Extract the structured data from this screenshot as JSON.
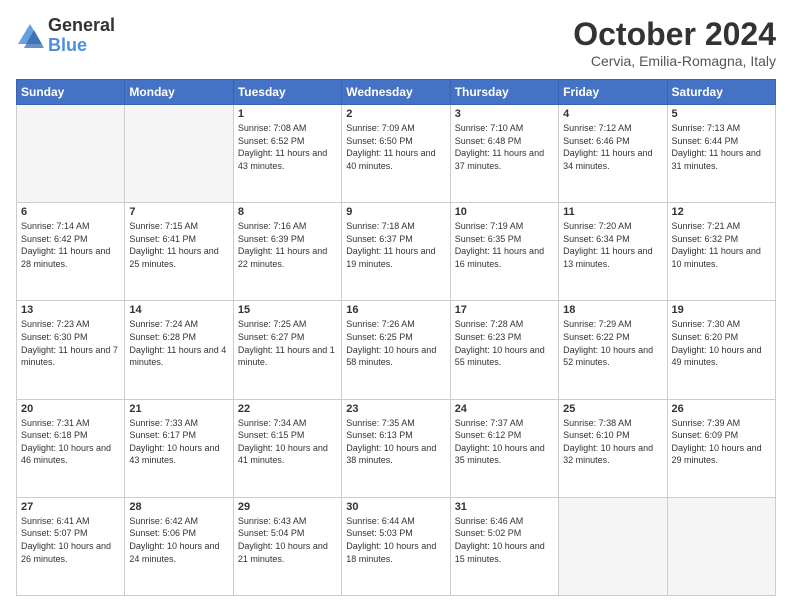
{
  "header": {
    "logo_line1": "General",
    "logo_line2": "Blue",
    "title": "October 2024",
    "subtitle": "Cervia, Emilia-Romagna, Italy"
  },
  "days_of_week": [
    "Sunday",
    "Monday",
    "Tuesday",
    "Wednesday",
    "Thursday",
    "Friday",
    "Saturday"
  ],
  "weeks": [
    [
      {
        "day": "",
        "info": ""
      },
      {
        "day": "",
        "info": ""
      },
      {
        "day": "1",
        "info": "Sunrise: 7:08 AM\nSunset: 6:52 PM\nDaylight: 11 hours and 43 minutes."
      },
      {
        "day": "2",
        "info": "Sunrise: 7:09 AM\nSunset: 6:50 PM\nDaylight: 11 hours and 40 minutes."
      },
      {
        "day": "3",
        "info": "Sunrise: 7:10 AM\nSunset: 6:48 PM\nDaylight: 11 hours and 37 minutes."
      },
      {
        "day": "4",
        "info": "Sunrise: 7:12 AM\nSunset: 6:46 PM\nDaylight: 11 hours and 34 minutes."
      },
      {
        "day": "5",
        "info": "Sunrise: 7:13 AM\nSunset: 6:44 PM\nDaylight: 11 hours and 31 minutes."
      }
    ],
    [
      {
        "day": "6",
        "info": "Sunrise: 7:14 AM\nSunset: 6:42 PM\nDaylight: 11 hours and 28 minutes."
      },
      {
        "day": "7",
        "info": "Sunrise: 7:15 AM\nSunset: 6:41 PM\nDaylight: 11 hours and 25 minutes."
      },
      {
        "day": "8",
        "info": "Sunrise: 7:16 AM\nSunset: 6:39 PM\nDaylight: 11 hours and 22 minutes."
      },
      {
        "day": "9",
        "info": "Sunrise: 7:18 AM\nSunset: 6:37 PM\nDaylight: 11 hours and 19 minutes."
      },
      {
        "day": "10",
        "info": "Sunrise: 7:19 AM\nSunset: 6:35 PM\nDaylight: 11 hours and 16 minutes."
      },
      {
        "day": "11",
        "info": "Sunrise: 7:20 AM\nSunset: 6:34 PM\nDaylight: 11 hours and 13 minutes."
      },
      {
        "day": "12",
        "info": "Sunrise: 7:21 AM\nSunset: 6:32 PM\nDaylight: 11 hours and 10 minutes."
      }
    ],
    [
      {
        "day": "13",
        "info": "Sunrise: 7:23 AM\nSunset: 6:30 PM\nDaylight: 11 hours and 7 minutes."
      },
      {
        "day": "14",
        "info": "Sunrise: 7:24 AM\nSunset: 6:28 PM\nDaylight: 11 hours and 4 minutes."
      },
      {
        "day": "15",
        "info": "Sunrise: 7:25 AM\nSunset: 6:27 PM\nDaylight: 11 hours and 1 minute."
      },
      {
        "day": "16",
        "info": "Sunrise: 7:26 AM\nSunset: 6:25 PM\nDaylight: 10 hours and 58 minutes."
      },
      {
        "day": "17",
        "info": "Sunrise: 7:28 AM\nSunset: 6:23 PM\nDaylight: 10 hours and 55 minutes."
      },
      {
        "day": "18",
        "info": "Sunrise: 7:29 AM\nSunset: 6:22 PM\nDaylight: 10 hours and 52 minutes."
      },
      {
        "day": "19",
        "info": "Sunrise: 7:30 AM\nSunset: 6:20 PM\nDaylight: 10 hours and 49 minutes."
      }
    ],
    [
      {
        "day": "20",
        "info": "Sunrise: 7:31 AM\nSunset: 6:18 PM\nDaylight: 10 hours and 46 minutes."
      },
      {
        "day": "21",
        "info": "Sunrise: 7:33 AM\nSunset: 6:17 PM\nDaylight: 10 hours and 43 minutes."
      },
      {
        "day": "22",
        "info": "Sunrise: 7:34 AM\nSunset: 6:15 PM\nDaylight: 10 hours and 41 minutes."
      },
      {
        "day": "23",
        "info": "Sunrise: 7:35 AM\nSunset: 6:13 PM\nDaylight: 10 hours and 38 minutes."
      },
      {
        "day": "24",
        "info": "Sunrise: 7:37 AM\nSunset: 6:12 PM\nDaylight: 10 hours and 35 minutes."
      },
      {
        "day": "25",
        "info": "Sunrise: 7:38 AM\nSunset: 6:10 PM\nDaylight: 10 hours and 32 minutes."
      },
      {
        "day": "26",
        "info": "Sunrise: 7:39 AM\nSunset: 6:09 PM\nDaylight: 10 hours and 29 minutes."
      }
    ],
    [
      {
        "day": "27",
        "info": "Sunrise: 6:41 AM\nSunset: 5:07 PM\nDaylight: 10 hours and 26 minutes."
      },
      {
        "day": "28",
        "info": "Sunrise: 6:42 AM\nSunset: 5:06 PM\nDaylight: 10 hours and 24 minutes."
      },
      {
        "day": "29",
        "info": "Sunrise: 6:43 AM\nSunset: 5:04 PM\nDaylight: 10 hours and 21 minutes."
      },
      {
        "day": "30",
        "info": "Sunrise: 6:44 AM\nSunset: 5:03 PM\nDaylight: 10 hours and 18 minutes."
      },
      {
        "day": "31",
        "info": "Sunrise: 6:46 AM\nSunset: 5:02 PM\nDaylight: 10 hours and 15 minutes."
      },
      {
        "day": "",
        "info": ""
      },
      {
        "day": "",
        "info": ""
      }
    ]
  ]
}
